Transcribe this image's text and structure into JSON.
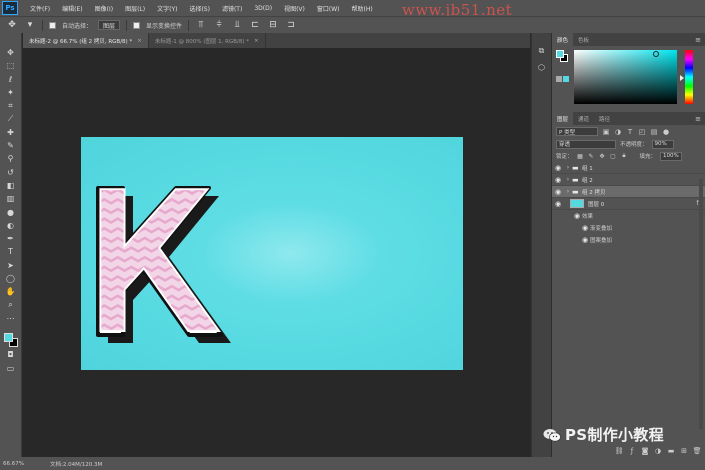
{
  "app": {
    "logo": "Ps"
  },
  "menu": [
    "文件(F)",
    "编辑(E)",
    "图像(I)",
    "图层(L)",
    "文字(Y)",
    "选择(S)",
    "滤镜(T)",
    "3D(D)",
    "视图(V)",
    "窗口(W)",
    "帮助(H)"
  ],
  "watermark_url": "www.jb51.net",
  "options": {
    "auto_select_label": "自动选择：",
    "auto_select_value": "图层",
    "show_transform_label": "显示变换控件"
  },
  "tabs": [
    {
      "label": "未标题-2 @ 66.7% (组 2 拷贝, RGB/8) *",
      "close": "×"
    },
    {
      "label": "未标题-1 @ 800% (图层 1, RGB/8) *",
      "close": "×"
    }
  ],
  "document": {
    "letter": "K",
    "bg_color": "#55d8e0",
    "letter_fill": "#f2d6e8",
    "stripe_color": "#e7a8cc",
    "outline_color": "#111111"
  },
  "status": {
    "zoom": "66.67%",
    "doc_info": "文档:2.04M/120.3M"
  },
  "color_panel": {
    "tabs": [
      "颜色",
      "色板"
    ],
    "fg": "#55d9e0",
    "bg": "#000000"
  },
  "layers_panel": {
    "tabs": [
      "图层",
      "通道",
      "路径"
    ],
    "filter_kind": "P 类型",
    "blend_mode": "穿透",
    "opacity_label": "不透明度：",
    "opacity_value": "90%",
    "lock_label": "锁定：",
    "fill_label": "填充：",
    "fill_value": "100%",
    "layers": [
      {
        "name": "组 1",
        "type": "group",
        "selected": false
      },
      {
        "name": "组 2",
        "type": "group",
        "selected": false
      },
      {
        "name": "组 2 拷贝",
        "type": "group",
        "selected": true
      },
      {
        "name": "图层 0",
        "type": "layer",
        "selected": false,
        "fx": "fx"
      }
    ],
    "effects_label": "效果",
    "effects": [
      "渐变叠加",
      "图案叠加"
    ]
  },
  "credit": "PS制作小教程"
}
